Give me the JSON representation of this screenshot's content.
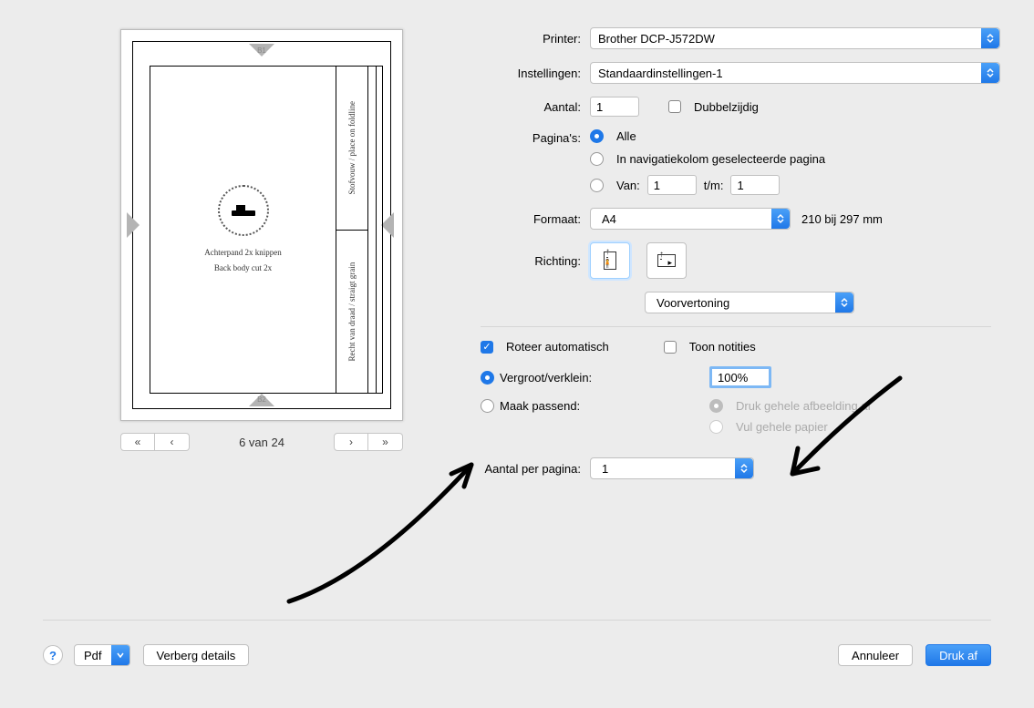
{
  "labels": {
    "printer": "Printer:",
    "settings": "Instellingen:",
    "copies": "Aantal:",
    "duplex": "Dubbelzijdig",
    "pages": "Pagina's:",
    "pages_all": "Alle",
    "pages_nav": "In navigatiekolom geselecteerde pagina",
    "pages_from": "Van:",
    "pages_to": "t/m:",
    "format": "Formaat:",
    "format_dim": "210 bij 297 mm",
    "orientation": "Richting:",
    "section": "Voorvertoning",
    "rotate_auto": "Roteer automatisch",
    "show_notes": "Toon notities",
    "scale": "Vergroot/verklein:",
    "fit": "Maak passend:",
    "fit_whole_image": "Druk gehele afbeelding af",
    "fit_whole_paper": "Vul gehele papier",
    "per_page": "Aantal per pagina:",
    "pdf": "Pdf",
    "hide_details": "Verberg details",
    "cancel": "Annuleer",
    "print": "Druk af"
  },
  "values": {
    "printer": "Brother DCP-J572DW",
    "settings": "Standaardinstellingen-1",
    "copies": "1",
    "duplex": false,
    "pages_mode": "all",
    "pages_from": "1",
    "pages_to": "1",
    "format": "A4",
    "rotate_auto": true,
    "show_notes": false,
    "scale_mode": "scale",
    "scale_pct": "100%",
    "fit_option": "whole_image",
    "per_page": "1",
    "page_indicator": "6 van 24"
  },
  "preview": {
    "reg_top": "B1",
    "reg_bottom": "B2",
    "line1": "Achterpand 2x knippen",
    "line2": "Back body cut 2x",
    "side_top": "Stofvouw / place on foldline",
    "side_bottom": "Recht van draad / straigt grain"
  }
}
